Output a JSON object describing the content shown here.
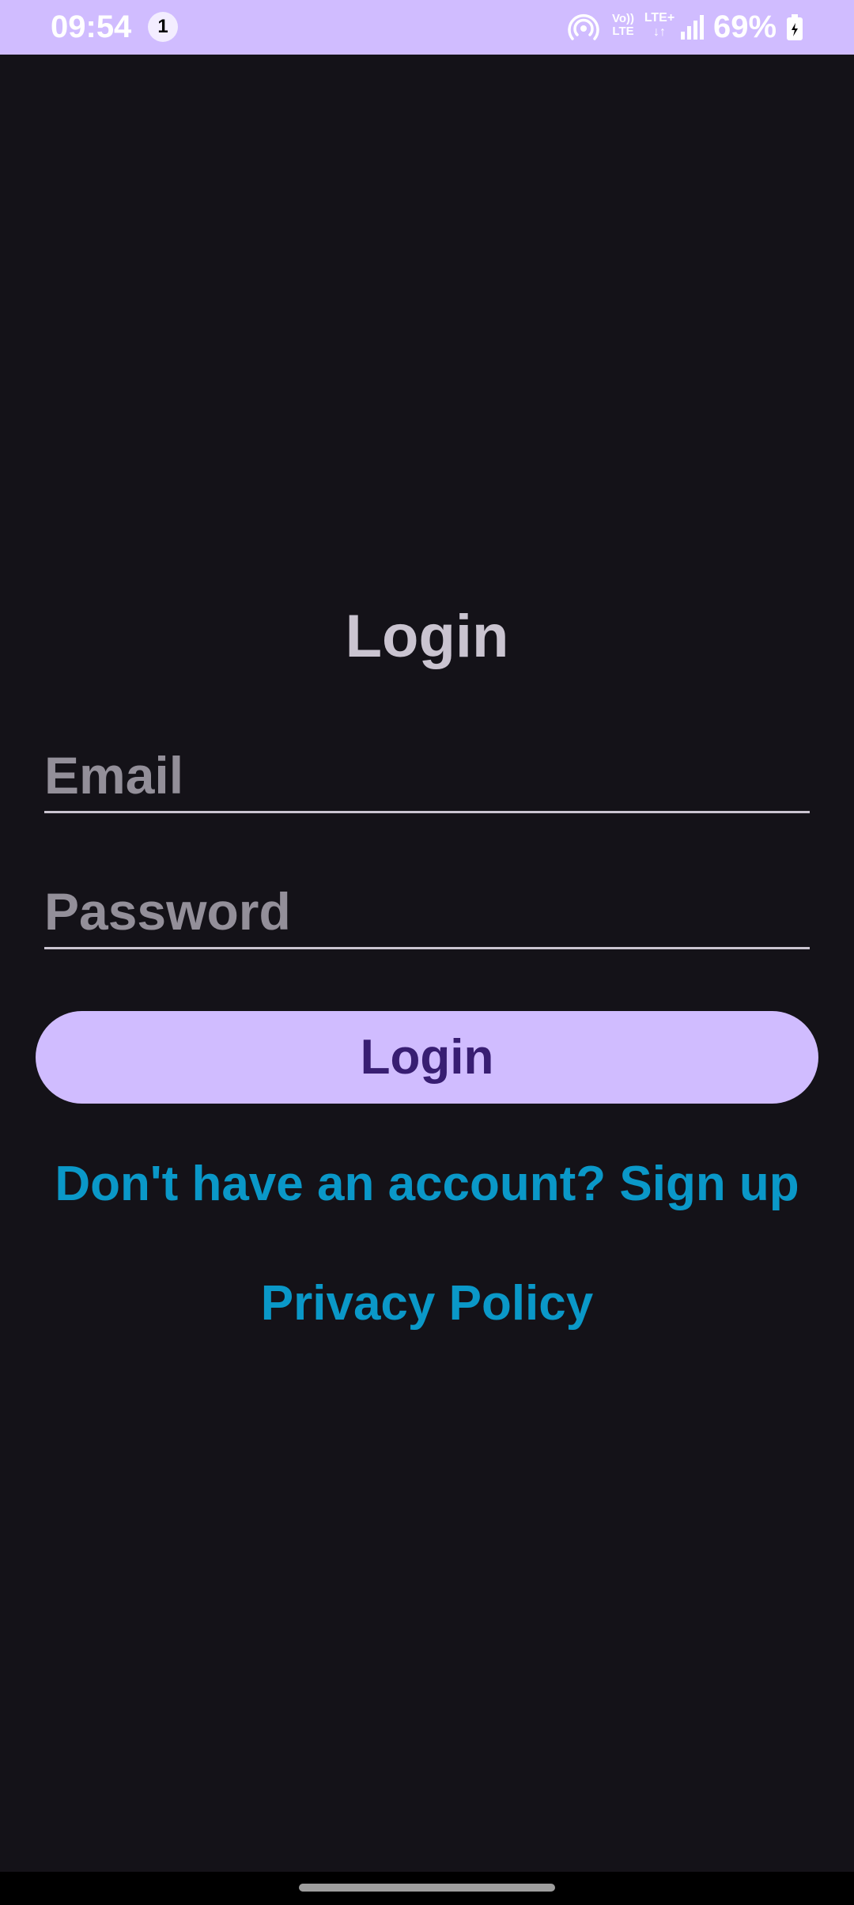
{
  "status_bar": {
    "time": "09:54",
    "notification_count": "1",
    "volte_top": "Vo))",
    "volte_bottom": "LTE",
    "lte_label": "LTE+",
    "lte_arrows": "↓↑",
    "battery": "69%",
    "icons": [
      "hotspot-icon",
      "volte-icon",
      "lte-icon",
      "signal-icon",
      "battery-icon"
    ]
  },
  "login": {
    "title": "Login",
    "email_placeholder": "Email",
    "password_placeholder": "Password",
    "button_label": "Login",
    "signup_link": "Don't have an account? Sign up",
    "privacy_link": "Privacy Policy"
  },
  "colors": {
    "background": "#141218",
    "accent": "#D0BCFF",
    "button_text": "#381E72",
    "link": "#0A98C8",
    "title": "#CAC4D0",
    "placeholder": "#938F99"
  }
}
